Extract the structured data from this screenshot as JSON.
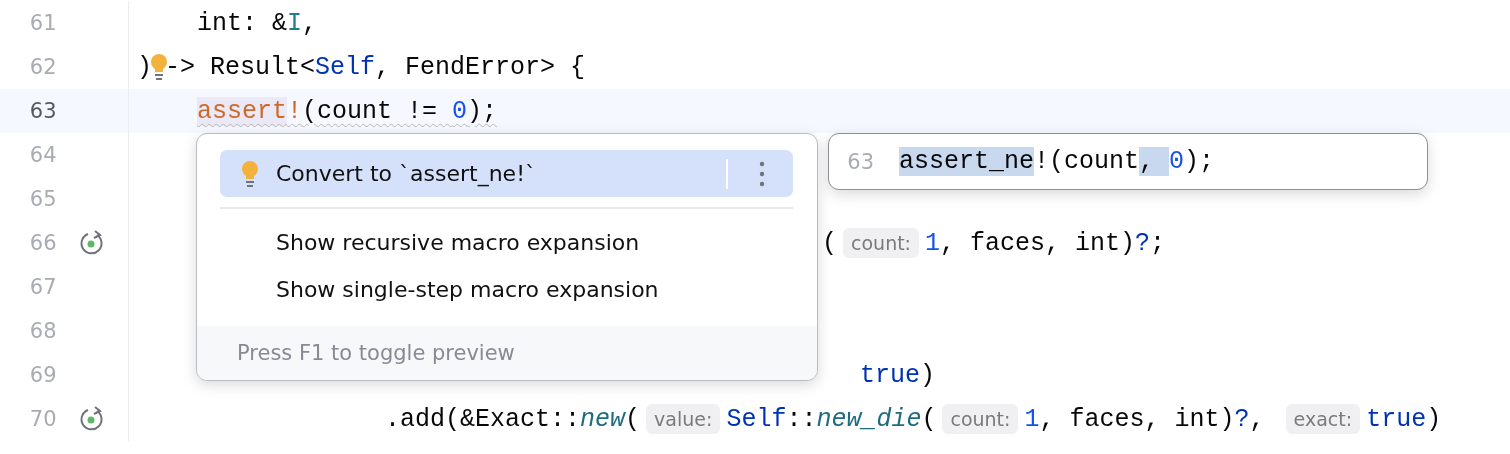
{
  "editor": {
    "lines": [
      {
        "number": "61",
        "kind": "body",
        "current": false,
        "run_marker": false,
        "warning": false,
        "tokens": [
          {
            "kind": "plain",
            "text": "int: &"
          },
          {
            "kind": "type",
            "text": "I"
          },
          {
            "kind": "plain",
            "text": ","
          }
        ]
      },
      {
        "number": "62",
        "kind": "signature",
        "current": false,
        "run_marker": false,
        "warning": false,
        "tokens": [
          {
            "kind": "plain",
            "text": ")"
          },
          {
            "kind": "bulb"
          },
          {
            "kind": "plain",
            "text": "-> Result<"
          },
          {
            "kind": "keyword",
            "text": "Self"
          },
          {
            "kind": "plain",
            "text": ", FendError> {"
          }
        ]
      },
      {
        "number": "63",
        "kind": "body",
        "current": true,
        "run_marker": false,
        "warning": true,
        "tokens": [
          {
            "kind": "macro_match",
            "text": "assert"
          },
          {
            "kind": "macro",
            "text": "!"
          },
          {
            "kind": "plain",
            "text": "(count != "
          },
          {
            "kind": "number",
            "text": "0"
          },
          {
            "kind": "plain",
            "text": ");"
          }
        ]
      },
      {
        "number": "64",
        "kind": "body",
        "current": false,
        "run_marker": false,
        "warning": false
      },
      {
        "number": "65",
        "kind": "body",
        "current": false,
        "run_marker": false,
        "warning": false
      },
      {
        "number": "66",
        "kind": "after_popup",
        "current": false,
        "run_marker": true,
        "warning": false,
        "tokens": [
          {
            "kind": "plain",
            "text": "("
          },
          {
            "kind": "hint",
            "text": "count:"
          },
          {
            "kind": "number",
            "text": "1"
          },
          {
            "kind": "plain",
            "text": ", faces, int)"
          },
          {
            "kind": "keyword",
            "text": "?"
          },
          {
            "kind": "plain",
            "text": ";"
          }
        ]
      },
      {
        "number": "67",
        "kind": "body",
        "current": false,
        "run_marker": false,
        "warning": false
      },
      {
        "number": "68",
        "kind": "body",
        "current": false,
        "run_marker": false,
        "warning": false
      },
      {
        "number": "69",
        "kind": "after_popup_hint",
        "current": false,
        "run_marker": false,
        "warning": false,
        "tokens": [
          {
            "kind": "keyword",
            "text": "true"
          },
          {
            "kind": "plain",
            "text": ")"
          }
        ]
      },
      {
        "number": "70",
        "kind": "chain",
        "current": false,
        "run_marker": true,
        "warning": false,
        "tokens": [
          {
            "kind": "plain",
            "text": ".add(&Exact::"
          },
          {
            "kind": "fn",
            "text": "new"
          },
          {
            "kind": "plain",
            "text": "("
          },
          {
            "kind": "hint",
            "text": "value:"
          },
          {
            "kind": "keyword",
            "text": "Self"
          },
          {
            "kind": "plain",
            "text": "::"
          },
          {
            "kind": "fn",
            "text": "new_die"
          },
          {
            "kind": "plain",
            "text": "("
          },
          {
            "kind": "hint",
            "text": "count:"
          },
          {
            "kind": "number",
            "text": "1"
          },
          {
            "kind": "plain",
            "text": ", faces, int)"
          },
          {
            "kind": "keyword",
            "text": "?"
          },
          {
            "kind": "plain",
            "text": ", "
          },
          {
            "kind": "hint",
            "text": "exact:"
          },
          {
            "kind": "keyword",
            "text": "true"
          },
          {
            "kind": "plain",
            "text": ")"
          }
        ]
      }
    ]
  },
  "popup": {
    "actions": [
      {
        "kind": "quickfix",
        "label": "Convert to `assert_ne!`",
        "selected": true
      },
      {
        "kind": "action",
        "label": "Show recursive macro expansion",
        "selected": false
      },
      {
        "kind": "action",
        "label": "Show single-step macro expansion",
        "selected": false
      }
    ],
    "footer": "Press F1 to toggle preview"
  },
  "preview": {
    "line_number": "63",
    "tokens": [
      {
        "kind": "match",
        "text": "assert_ne"
      },
      {
        "kind": "plain",
        "text": "!(count"
      },
      {
        "kind": "match",
        "text": ", "
      },
      {
        "kind": "number",
        "text": "0"
      },
      {
        "kind": "plain",
        "text": ");"
      }
    ]
  }
}
